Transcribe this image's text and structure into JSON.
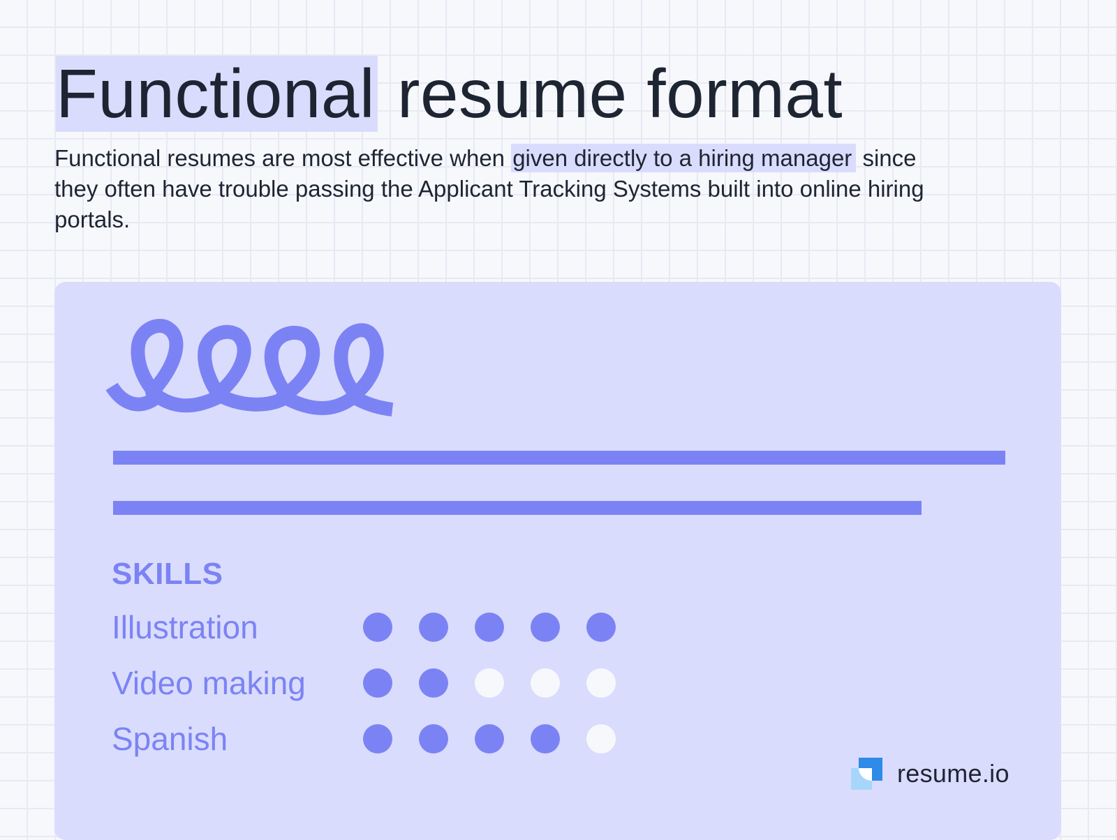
{
  "header": {
    "title_highlight": "Functional",
    "title_rest": " resume format",
    "subtitle_before": "Functional resumes are most effective when ",
    "subtitle_highlight": "given directly to a hiring manager",
    "subtitle_after": " since they often have trouble passing the Applicant Tracking Systems built into online hiring portals."
  },
  "card": {
    "signature_icon": "handwritten-signature-loops",
    "skills_heading": "SKILLS",
    "skills": [
      {
        "name": "Illustration",
        "level": 5,
        "max": 5
      },
      {
        "name": "Video making",
        "level": 2,
        "max": 5
      },
      {
        "name": "Spanish",
        "level": 4,
        "max": 5
      }
    ]
  },
  "brand": {
    "logo_icon": "resume-io-logo",
    "name": "resume.io"
  },
  "colors": {
    "background": "#f7f8fc",
    "grid": "#e8e9f3",
    "highlight": "#dadcfd",
    "card": "#dadcfd",
    "accent": "#7b83f4",
    "text": "#1e2532",
    "dot_empty": "#f7f8fc",
    "logo_dark": "#2f8ae8",
    "logo_light": "#a6d6fa"
  }
}
